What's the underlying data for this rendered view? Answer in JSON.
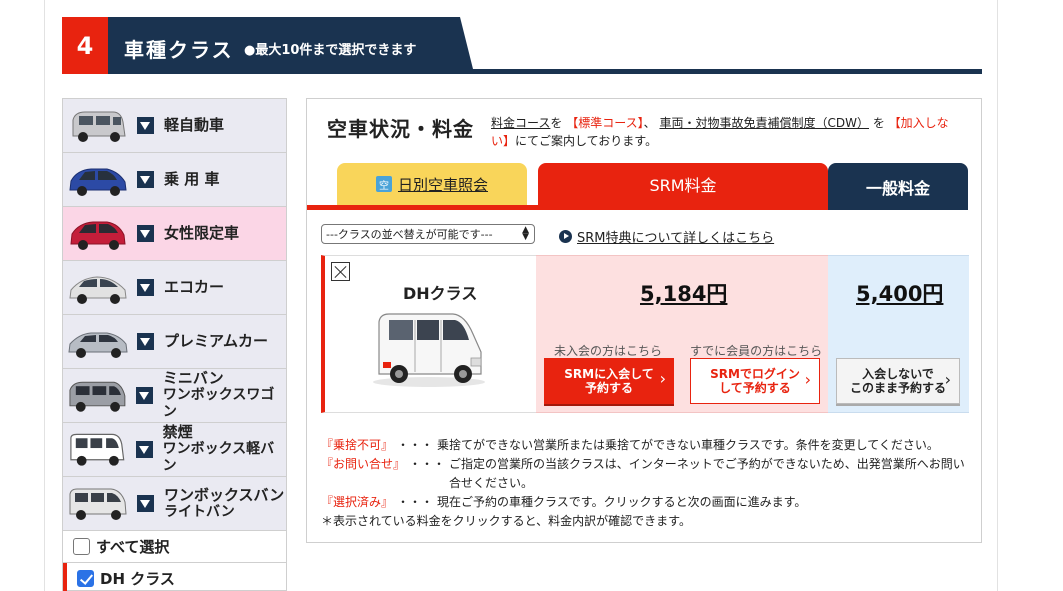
{
  "section": {
    "number": "4",
    "title": "車種クラス",
    "note": "●最大10件まで選択できます"
  },
  "sidebar": {
    "categories": [
      {
        "label": "軽自動車",
        "label2": "",
        "icon": "kei-car-icon",
        "color": "#c9c9cc"
      },
      {
        "label": "乗 用 車",
        "label2": "",
        "icon": "sedan-car-icon",
        "color": "#2c4aa5"
      },
      {
        "label": "女性限定車",
        "label2": "",
        "icon": "compact-car-icon",
        "color": "#c41e3a"
      },
      {
        "label": "エコカー",
        "label2": "",
        "icon": "eco-car-icon",
        "color": "#d8d8d8"
      },
      {
        "label": "プレミアムカー",
        "label2": "",
        "icon": "premium-car-icon",
        "color": "#b7bcc4"
      },
      {
        "label": "ミニバン",
        "label2": "ワンボックスワゴン",
        "icon": "minivan-icon",
        "color": "#9b9ea5"
      },
      {
        "label": "禁煙",
        "label2": "ワンボックス軽バン",
        "icon": "nonsmoking-van-icon",
        "color": "#ffffff"
      },
      {
        "label": "ワンボックスバン",
        "label2": "ライトバン",
        "icon": "light-van-icon",
        "color": "#e6e6e6"
      }
    ],
    "select_all": "すべて選択",
    "selected_item": "DH クラス"
  },
  "main": {
    "title": "空車状況・料金",
    "desc": {
      "p1": "料金コース",
      "p2": "を",
      "p3": "【標準コース】",
      "p4": "、",
      "p5": "車両・対物事故免責補償制度（CDW）",
      "p6": "を",
      "p7": "【加入しない】",
      "p8": "にてご案内しております。"
    },
    "tabs": {
      "daily": "日別空車照会",
      "daily_icon": "空",
      "srm": "SRM料金",
      "general": "一般料金"
    },
    "sort_label": "---クラスの並べ替えが可能です---",
    "srm_link": "SRM特典について詳しくはこちら"
  },
  "row": {
    "class_name": "DHクラス",
    "srm_price": "5,184円",
    "general_price": "5,400円",
    "nonmember_label": "未入会の方はこちら",
    "member_label": "すでに会員の方はこちら",
    "join_button_line1": "SRMに入会して",
    "join_button_line2": "予約する",
    "login_button_line1": "SRMでログイン",
    "login_button_line2": "して予約する",
    "guest_button_line1": "入会しないで",
    "guest_button_line2": "このまま予約する"
  },
  "notes": [
    {
      "key": "『乗捨不可』",
      "dots": "・・・",
      "text": "乗捨てができない営業所または乗捨てができない車種クラスです。条件を変更してください。"
    },
    {
      "key": "『お問い合せ』",
      "dots": "・・・",
      "text": "ご指定の営業所の当該クラスは、インターネットでご予約ができないため、出発営業所へお問い合せください。"
    },
    {
      "key": "『選択済み』",
      "dots": "・・・",
      "text": "現在ご予約の車種クラスです。クリックすると次の画面に進みます。"
    }
  ],
  "footnote": "＊表示されている料金をクリックすると、料金内訳が確認できます。",
  "colors": {
    "accent_red": "#e8230f",
    "navy": "#1a3350",
    "tab_yellow": "#f9d55a",
    "srm_bg": "#fde0e0",
    "general_bg": "#dfeefb",
    "female_bg": "#fbd6e6"
  }
}
